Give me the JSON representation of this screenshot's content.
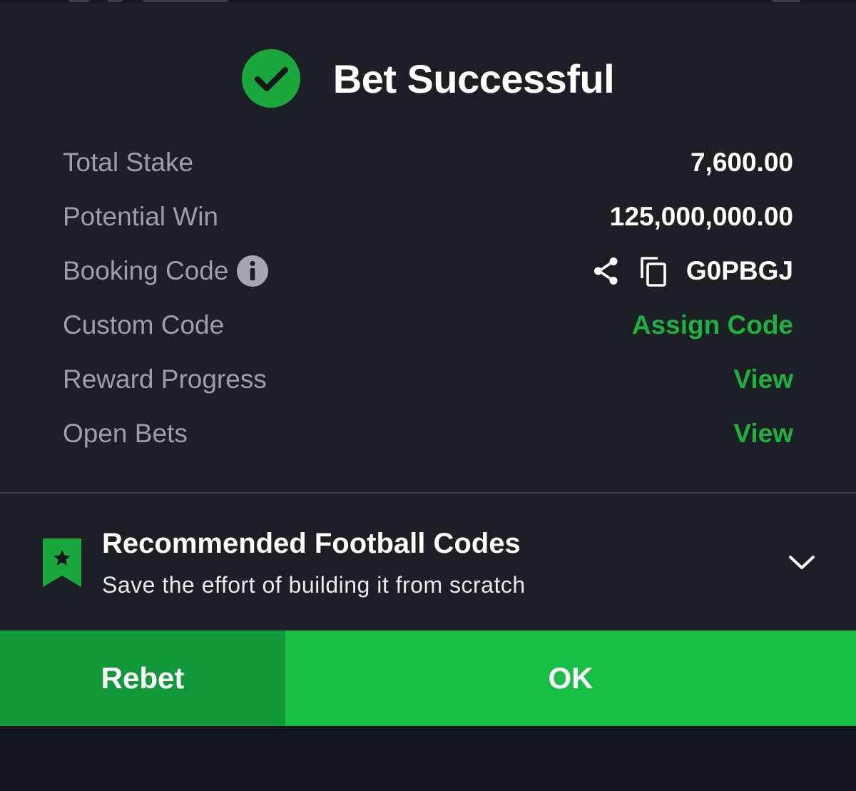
{
  "header": {
    "title": "Bet Successful",
    "icon": "check-circle-icon",
    "accent_color": "#1db23f"
  },
  "rows": [
    {
      "label": "Total Stake",
      "value": "7,600.00"
    },
    {
      "label": "Potential Win",
      "value": "125,000,000.00"
    },
    {
      "label": "Booking Code",
      "label_icon": "info-icon",
      "value": "G0PBGJ",
      "actions": [
        "share-icon",
        "copy-icon"
      ]
    },
    {
      "label": "Custom Code",
      "link": "Assign Code"
    },
    {
      "label": "Reward Progress",
      "link": "View"
    },
    {
      "label": "Open Bets",
      "link": "View"
    }
  ],
  "recommended": {
    "icon": "bookmark-star-icon",
    "title": "Recommended Football Codes",
    "subtitle": "Save the effort of building it from scratch",
    "toggle_icon": "chevron-down-icon"
  },
  "buttons": {
    "rebet_label": "Rebet",
    "ok_label": "OK",
    "rebet_color": "#12993a",
    "ok_color": "#19be45"
  }
}
